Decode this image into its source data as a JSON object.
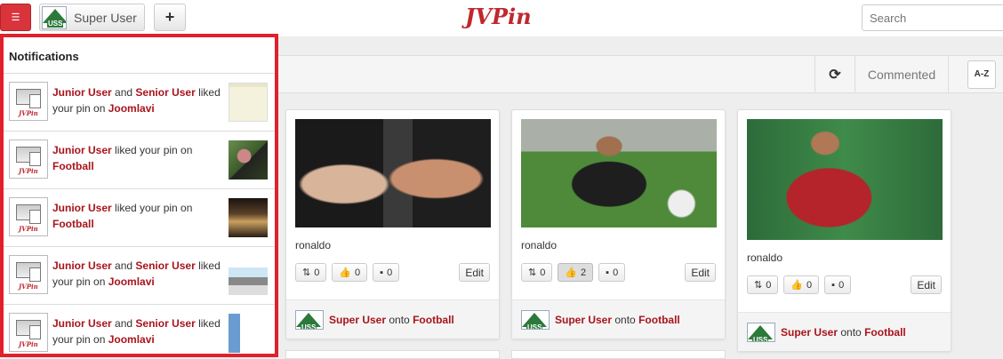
{
  "header": {
    "user_name": "Super User",
    "avatar_text": "USS",
    "add_label": "+",
    "logo": "JVPin",
    "search_placeholder": "Search"
  },
  "toolbar": {
    "refresh_icon": "⟳",
    "sort_label": "Commented",
    "sort_icon": "A-Z"
  },
  "notifications": {
    "title": "Notifications",
    "avatar_brand": "JVPin",
    "items": [
      {
        "actor1": "Junior User",
        "join": " and ",
        "actor2": "Senior User",
        "text": " liked your pin on ",
        "board": "Joomlavi"
      },
      {
        "actor1": "Junior User",
        "join": "",
        "actor2": "",
        "text": " liked your pin on ",
        "board": "Football"
      },
      {
        "actor1": "Junior User",
        "join": "",
        "actor2": "",
        "text": " liked your pin on ",
        "board": "Football"
      },
      {
        "actor1": "Junior User",
        "join": " and ",
        "actor2": "Senior User",
        "text": " liked your pin on ",
        "board": "Joomlavi"
      },
      {
        "actor1": "Junior User",
        "join": " and ",
        "actor2": "Senior User",
        "text": " liked your pin on ",
        "board": "Joomlavi"
      }
    ]
  },
  "pins": [
    {
      "title": "ronaldo",
      "repins": "0",
      "likes": "0",
      "comments": "0",
      "edit": "Edit",
      "author": "Super User",
      "onto": "onto",
      "board": "Football"
    },
    {
      "title": "ronaldo",
      "repins": "0",
      "likes": "2",
      "comments": "0",
      "edit": "Edit",
      "author": "Super User",
      "onto": "onto",
      "board": "Football"
    },
    {
      "title": "ronaldo",
      "repins": "0",
      "likes": "0",
      "comments": "0",
      "edit": "Edit",
      "author": "Super User",
      "onto": "onto",
      "board": "Football"
    }
  ]
}
